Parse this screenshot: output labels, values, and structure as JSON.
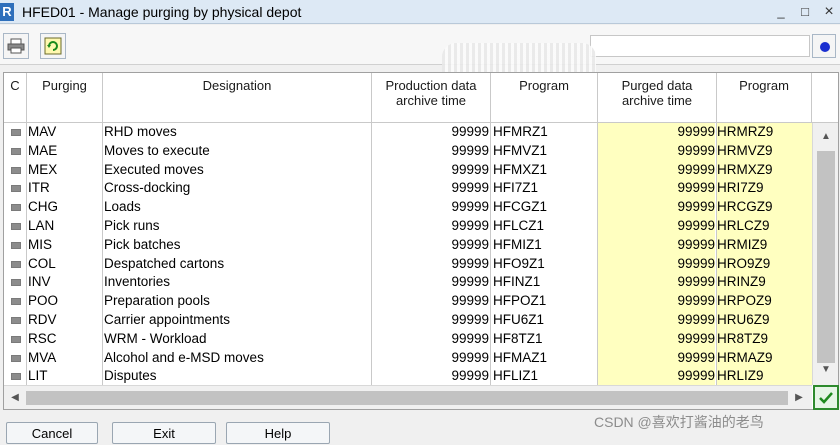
{
  "window": {
    "logo": "R",
    "title": "HFED01 - Manage purging by physical depot"
  },
  "window_controls": {
    "minimize": "_",
    "maximize": "□",
    "close": "×"
  },
  "toolbar": {
    "print_icon": "printer-icon",
    "refresh_icon": "refresh-icon",
    "search_value": ""
  },
  "grid": {
    "headers": {
      "c": "C",
      "purging": "Purging",
      "designation": "Designation",
      "prod_line1": "Production data",
      "prod_line2": "archive time",
      "program1": "Program",
      "purged_line1": "Purged data",
      "purged_line2": "archive time",
      "program2": "Program"
    },
    "rows": [
      {
        "code": "MAV",
        "designation": "RHD moves",
        "prod": "99999",
        "prog1": "HFMRZ1",
        "purged": "99999",
        "prog2": "HRMRZ9"
      },
      {
        "code": "MAE",
        "designation": "Moves to execute",
        "prod": "99999",
        "prog1": "HFMVZ1",
        "purged": "99999",
        "prog2": "HRMVZ9"
      },
      {
        "code": "MEX",
        "designation": "Executed moves",
        "prod": "99999",
        "prog1": "HFMXZ1",
        "purged": "99999",
        "prog2": "HRMXZ9"
      },
      {
        "code": "ITR",
        "designation": "Cross-docking",
        "prod": "99999",
        "prog1": "HFI7Z1",
        "purged": "99999",
        "prog2": "HRI7Z9"
      },
      {
        "code": "CHG",
        "designation": "Loads",
        "prod": "99999",
        "prog1": "HFCGZ1",
        "purged": "99999",
        "prog2": "HRCGZ9"
      },
      {
        "code": "LAN",
        "designation": "Pick runs",
        "prod": "99999",
        "prog1": "HFLCZ1",
        "purged": "99999",
        "prog2": "HRLCZ9"
      },
      {
        "code": "MIS",
        "designation": "Pick batches",
        "prod": "99999",
        "prog1": "HFMIZ1",
        "purged": "99999",
        "prog2": "HRMIZ9"
      },
      {
        "code": "COL",
        "designation": "Despatched cartons",
        "prod": "99999",
        "prog1": "HFO9Z1",
        "purged": "99999",
        "prog2": "HRO9Z9"
      },
      {
        "code": "INV",
        "designation": "Inventories",
        "prod": "99999",
        "prog1": "HFINZ1",
        "purged": "99999",
        "prog2": "HRINZ9"
      },
      {
        "code": "POO",
        "designation": "Preparation pools",
        "prod": "99999",
        "prog1": "HFPOZ1",
        "purged": "99999",
        "prog2": "HRPOZ9"
      },
      {
        "code": "RDV",
        "designation": "Carrier appointments",
        "prod": "99999",
        "prog1": "HFU6Z1",
        "purged": "99999",
        "prog2": "HRU6Z9"
      },
      {
        "code": "RSC",
        "designation": "WRM - Workload",
        "prod": "99999",
        "prog1": "HF8TZ1",
        "purged": "99999",
        "prog2": "HR8TZ9"
      },
      {
        "code": "MVA",
        "designation": "Alcohol and e-MSD moves",
        "prod": "99999",
        "prog1": "HFMAZ1",
        "purged": "99999",
        "prog2": "HRMAZ9"
      },
      {
        "code": "LIT",
        "designation": "Disputes",
        "prod": "99999",
        "prog1": "HFLIZ1",
        "purged": "99999",
        "prog2": "HRLIZ9"
      }
    ],
    "highlight_color": "#ffffc0"
  },
  "buttons": {
    "cancel": "Cancel",
    "exit": "Exit",
    "help": "Help"
  },
  "watermark": "CSDN @喜欢打酱油的老鸟"
}
